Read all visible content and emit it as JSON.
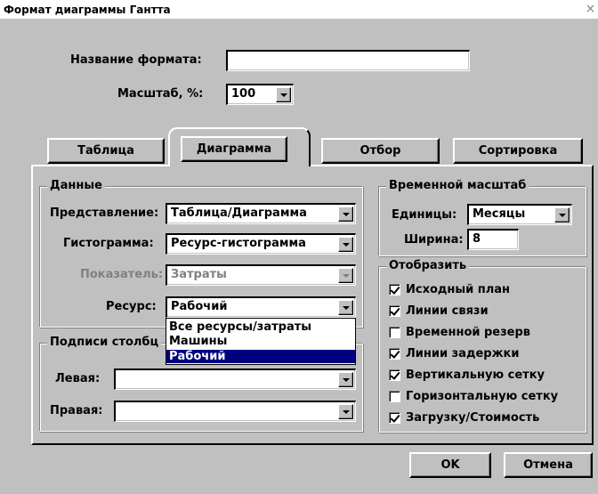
{
  "window": {
    "title": "Формат диаграммы Гантта",
    "close": "×"
  },
  "format_name": {
    "label": "Название формата:",
    "value": ""
  },
  "scale": {
    "label": "Масштаб, %:",
    "value": "100"
  },
  "tabs": [
    {
      "label": "Таблица",
      "active": false
    },
    {
      "label": "Диаграмма",
      "active": true
    },
    {
      "label": "Отбор",
      "active": false
    },
    {
      "label": "Сортировка",
      "active": false
    }
  ],
  "data_group": {
    "legend": "Данные",
    "view_label": "Представление:",
    "view_value": "Таблица/Диаграмма",
    "histogram_label": "Гистограмма:",
    "histogram_value": "Ресурс-гистограмма",
    "metric_label": "Показатель:",
    "metric_value": "Затраты",
    "resource_label": "Ресурс:",
    "resource_value": "Рабочий",
    "resource_options": [
      "Все ресурсы/затраты",
      "Машины",
      "Рабочий"
    ]
  },
  "labels_group": {
    "legend": "Подписи столбц",
    "left_label": "Левая:",
    "left_value": "",
    "right_label": "Правая:",
    "right_value": ""
  },
  "timescale_group": {
    "legend": "Временной масштаб",
    "units_label": "Единицы:",
    "units_value": "Месяцы",
    "width_label": "Ширина:",
    "width_value": "8"
  },
  "display_group": {
    "legend": "Отобразить",
    "items": [
      {
        "label": "Исходный план",
        "checked": true
      },
      {
        "label": "Линии связи",
        "checked": true
      },
      {
        "label": "Временной резерв",
        "checked": false
      },
      {
        "label": "Линии задержки",
        "checked": true
      },
      {
        "label": "Вертикальную сетку",
        "checked": true
      },
      {
        "label": "Горизонтальную сетку",
        "checked": false
      },
      {
        "label": "Загрузку/Стоимость",
        "checked": true
      }
    ]
  },
  "buttons": {
    "ok": "OK",
    "cancel": "Отмена"
  }
}
